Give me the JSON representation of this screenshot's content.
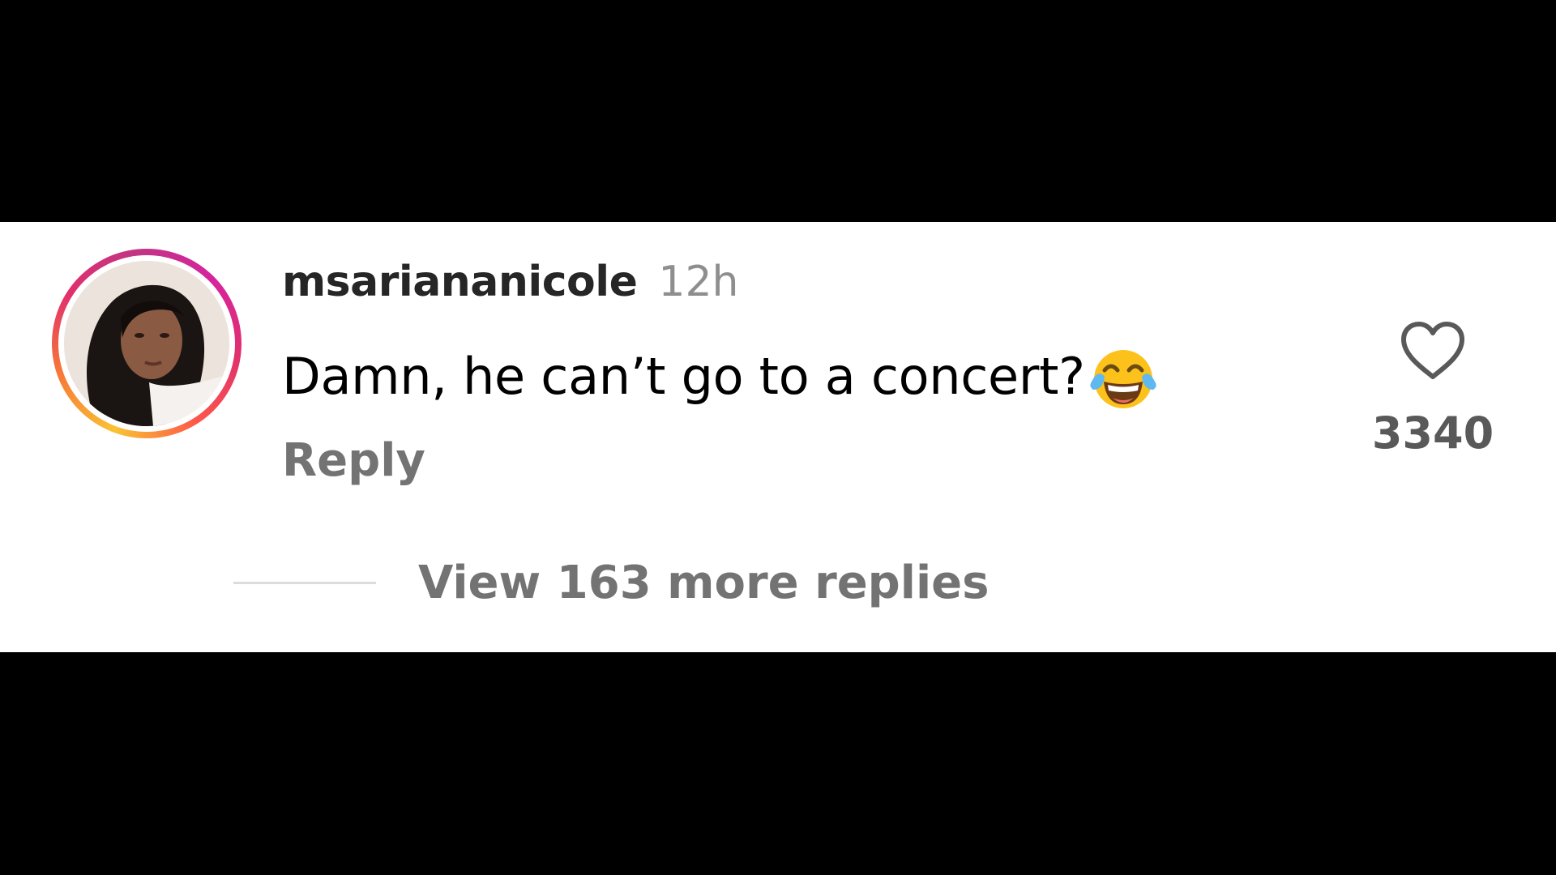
{
  "comment": {
    "username": "msariananicole",
    "timestamp": "12h",
    "text": "Damn, he can’t go to a concert?",
    "emoji": "face-with-tears-of-joy",
    "reply_label": "Reply",
    "like_count": "3340",
    "view_replies_label": "View 163 more replies"
  },
  "colors": {
    "letterbox": "#000000",
    "panel_background": "#ffffff",
    "username": "#262626",
    "secondary_text": "#737373",
    "timestamp": "#8e8e8e",
    "avatar_ring": [
      "#f9c333",
      "#f77737",
      "#e1306c",
      "#c13584"
    ]
  }
}
